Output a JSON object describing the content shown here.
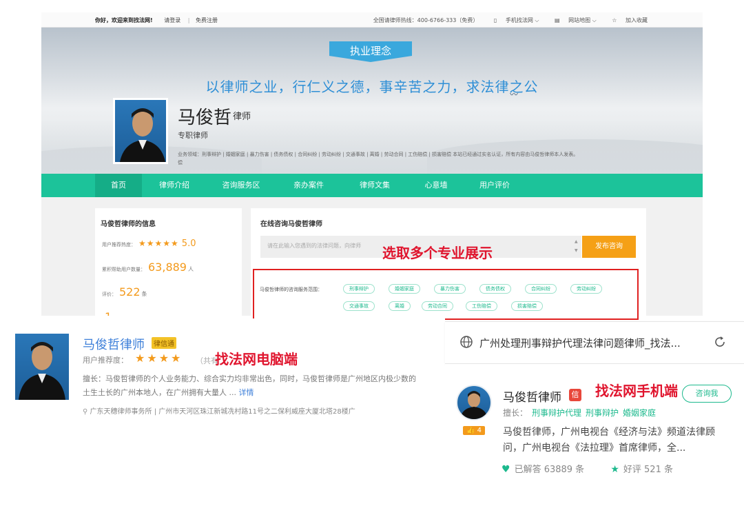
{
  "topbar": {
    "welcome": "你好，欢迎来到找法网!",
    "login": "请登录",
    "register": "免费注册",
    "hotline": "全国请律师热线：400-6766-333（免费）",
    "mobile_site": "手机找法网 ⌵",
    "site_map": "网站地图 ⌵",
    "favorite": "加入收藏"
  },
  "banner": {
    "ribbon": "执业理念",
    "motto": "以律师之业，行仁义之德，事辛苦之力，求法律之公"
  },
  "lawyer": {
    "name": "马俊哲",
    "title": "律师",
    "subtitle": "专职律师",
    "areas": "业务领域：刑事辩护 | 婚姻家庭 | 暴力伤害 | 债务债权 | 合同纠纷 | 劳动纠纷 | 交通事故 | 离婚 | 劳动合同 | 工伤赔偿 | 损害赔偿    本站已经通过实名认证，所有内容由马俊哲律师本人发表。",
    "areas_tail": "偿"
  },
  "nav": {
    "items": [
      "首页",
      "律师介绍",
      "咨询服务区",
      "亲办案件",
      "律师文集",
      "心意墙",
      "用户评价"
    ]
  },
  "info": {
    "heading": "马俊哲律师的信息",
    "rating_label": "用户推荐热度：",
    "rating_stars": "★★★★★",
    "rating_value": "5.0",
    "helped_label": "累积帮助用户数量：",
    "helped_value": "63,889",
    "helped_unit": "人",
    "review_label": "评价：",
    "review_value": "522",
    "review_unit": "条",
    "partial_value": "1"
  },
  "consult": {
    "heading": "在线咨询马俊哲律师",
    "placeholder": "请在此输入您遇到的法律问题，向律师",
    "button": "发布咨询",
    "scope_label": "马俊哲律师的咨询服务范围：",
    "tags": [
      "刑事辩护",
      "婚姻家庭",
      "暴力伤害",
      "债务债权",
      "合同纠纷",
      "劳动纠纷",
      "交通事故",
      "离婚",
      "劳动合同",
      "工伤赔偿",
      "损害赔偿"
    ]
  },
  "annotations": {
    "multi_practice": "选取多个专业展示",
    "pc": "找法网电脑端",
    "mobile": "找法网手机端"
  },
  "pc_card": {
    "name": "马俊哲律师",
    "badge": "律信通",
    "rec_label": "用户推荐度：",
    "stars": "★★★★",
    "count_partial": "（共有",
    "desc": "擅长：马俊哲律师的个人业务能力、综合实力均非常出色，同时，马俊哲律师是广州地区内极少数的土生土长的广州本地人，在广州拥有大量人 ...",
    "more": "详情",
    "address": "广东天穗律师事务所 | 广州市天河区珠江新城冼村路11号之二保利威座大厦北塔28楼广"
  },
  "mobile": {
    "page_title": "广州处理刑事辩护代理法律问题律师_找法...",
    "name": "马俊哲律师",
    "xin": "信",
    "consult_button": "咨询我",
    "field_label": "擅长：",
    "fields": [
      "刑事辩护代理",
      "刑事辩护",
      "婚姻家庭"
    ],
    "likes": "👍 4",
    "desc": "马俊哲律师，广州电视台《经济与法》频道法律顾问，广州电视台《法拉理》首席律师，全...",
    "answered": "已解答 63889 条",
    "good_reviews": "好评 521 条"
  }
}
